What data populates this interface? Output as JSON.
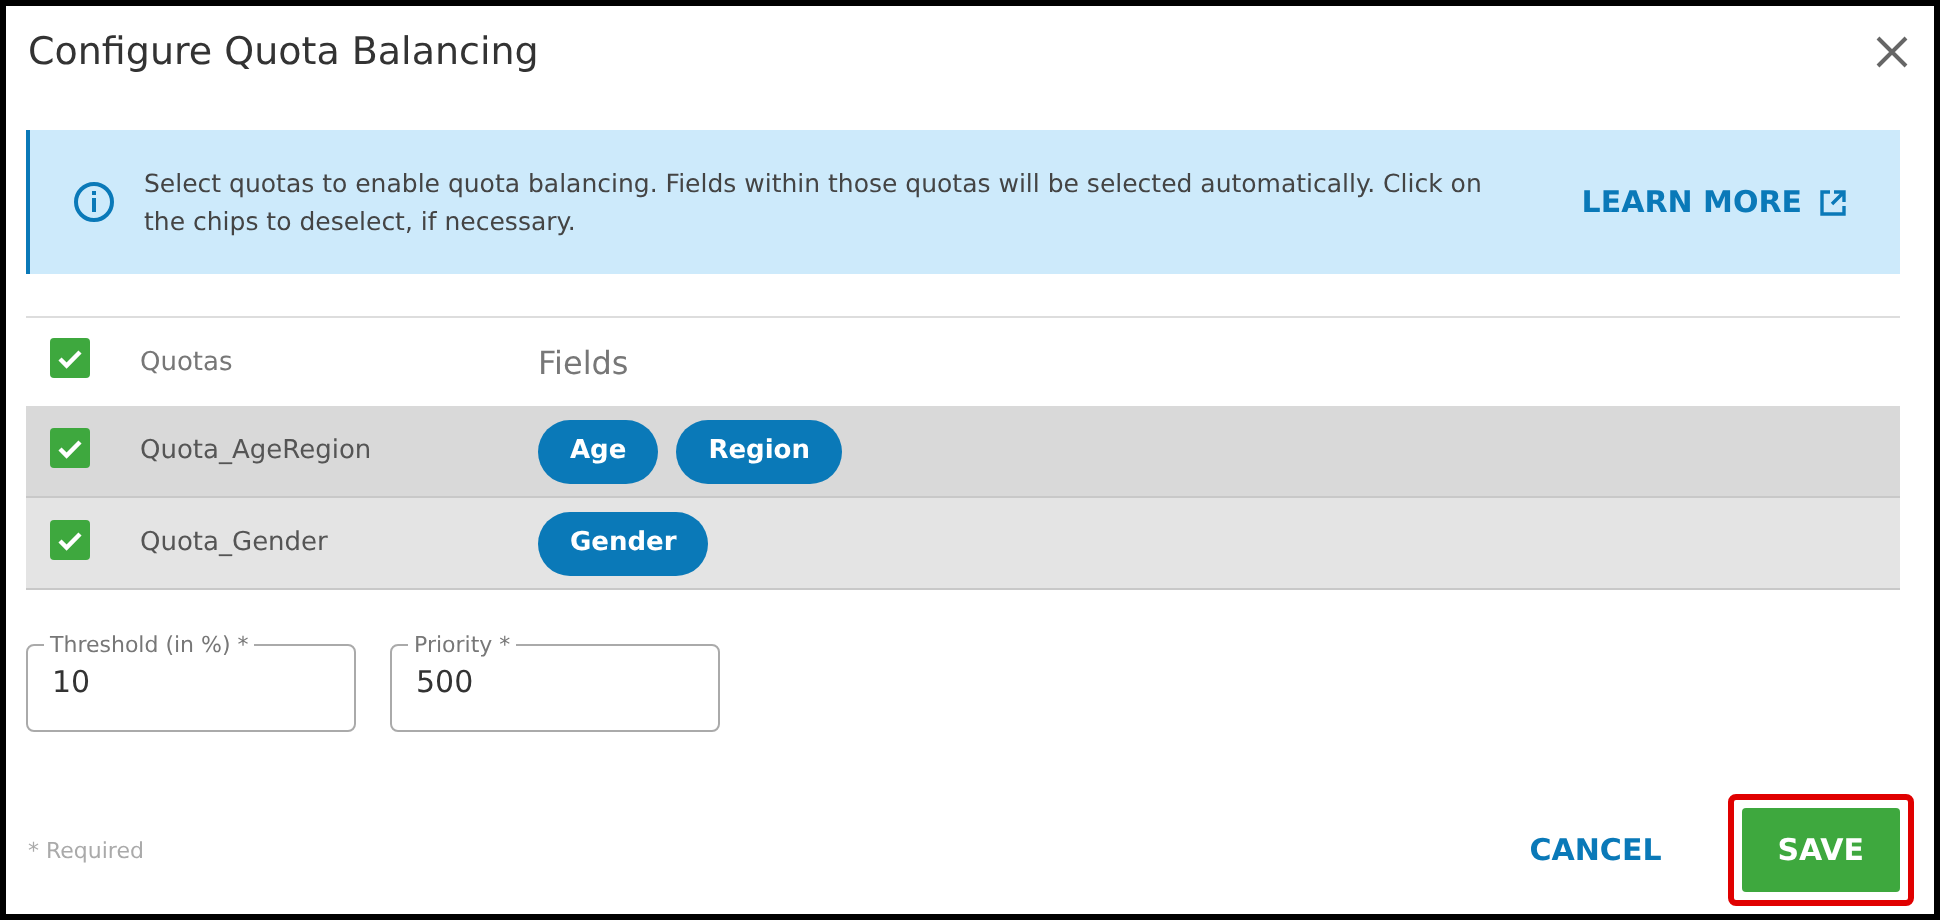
{
  "dialog": {
    "title": "Configure Quota Balancing"
  },
  "info": {
    "text": "Select quotas to enable quota balancing. Fields within those quotas will be selected automatically. Click on the chips to deselect, if necessary.",
    "link": "LEARN MORE"
  },
  "table": {
    "all_checked": true,
    "columns": [
      "Quotas",
      "Fields"
    ],
    "rows": [
      {
        "checked": true,
        "quota": "Quota_AgeRegion",
        "fields": [
          "Age",
          "Region"
        ]
      },
      {
        "checked": true,
        "quota": "Quota_Gender",
        "fields": [
          "Gender"
        ]
      }
    ]
  },
  "inputs": [
    {
      "label": "Threshold (in %) *",
      "value": "10"
    },
    {
      "label": "Priority *",
      "value": "500"
    }
  ],
  "footer": {
    "note": "* Required",
    "buttons": [
      {
        "label": "CANCEL",
        "kind": "text",
        "highlighted": false
      },
      {
        "label": "SAVE",
        "kind": "primary",
        "highlighted": true
      }
    ]
  }
}
